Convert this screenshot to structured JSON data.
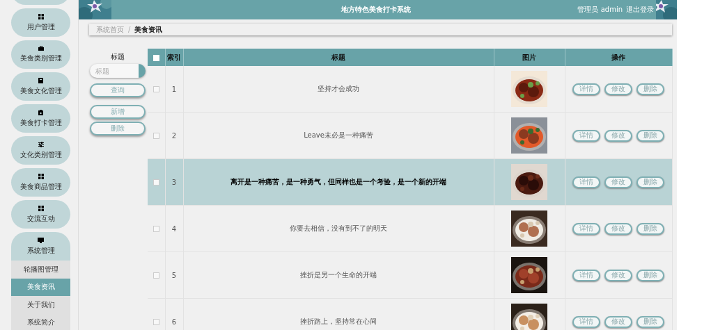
{
  "header": {
    "title": "地方特色美食打卡系统",
    "user": "管理员 admin",
    "logout": "退出登录"
  },
  "sidebar": {
    "items": [
      {
        "label": "用户管理"
      },
      {
        "label": "美食类别管理"
      },
      {
        "label": "美食文化管理"
      },
      {
        "label": "美食打卡管理"
      },
      {
        "label": "文化类别管理"
      },
      {
        "label": "美食商品管理"
      },
      {
        "label": "交流互动"
      },
      {
        "label": "系统管理",
        "children": [
          {
            "label": "轮播图管理",
            "selected": false
          },
          {
            "label": "美食资讯",
            "selected": true
          },
          {
            "label": "关于我们",
            "selected": false
          },
          {
            "label": "系统简介",
            "selected": false
          }
        ]
      }
    ]
  },
  "breadcrumb": {
    "items": [
      "系统首页",
      "美食资讯"
    ],
    "separator": "/"
  },
  "search": {
    "label": "标题",
    "placeholder": "标题",
    "buttons": [
      "查询",
      "新增",
      "删除"
    ]
  },
  "table": {
    "columns": [
      "索引",
      "标题",
      "图片",
      "操作"
    ],
    "header_checked": false,
    "rows": [
      {
        "index": "1",
        "title": "坚持才会成功",
        "checked": false,
        "highlighted": false,
        "actions": [
          "详情",
          "修改",
          "删除"
        ]
      },
      {
        "index": "2",
        "title": "Leave未必是一种痛苦",
        "checked": false,
        "highlighted": false,
        "actions": [
          "详情",
          "修改",
          "删除"
        ]
      },
      {
        "index": "3",
        "title": "离开是一种痛苦，是一种勇气，但同样也是一个考验，是一个新的开端",
        "checked": false,
        "highlighted": true,
        "actions": [
          "详情",
          "修改",
          "删除"
        ]
      },
      {
        "index": "4",
        "title": "你要去相信，没有到不了的明天",
        "checked": false,
        "highlighted": false,
        "actions": [
          "详情",
          "修改",
          "删除"
        ]
      },
      {
        "index": "5",
        "title": "挫折是另一个生命的开端",
        "checked": false,
        "highlighted": false,
        "actions": [
          "详情",
          "修改",
          "删除"
        ]
      },
      {
        "index": "6",
        "title": "挫折路上，坚持常在心间",
        "checked": false,
        "highlighted": false,
        "actions": [
          "详情",
          "修改",
          "删除"
        ]
      }
    ]
  }
}
